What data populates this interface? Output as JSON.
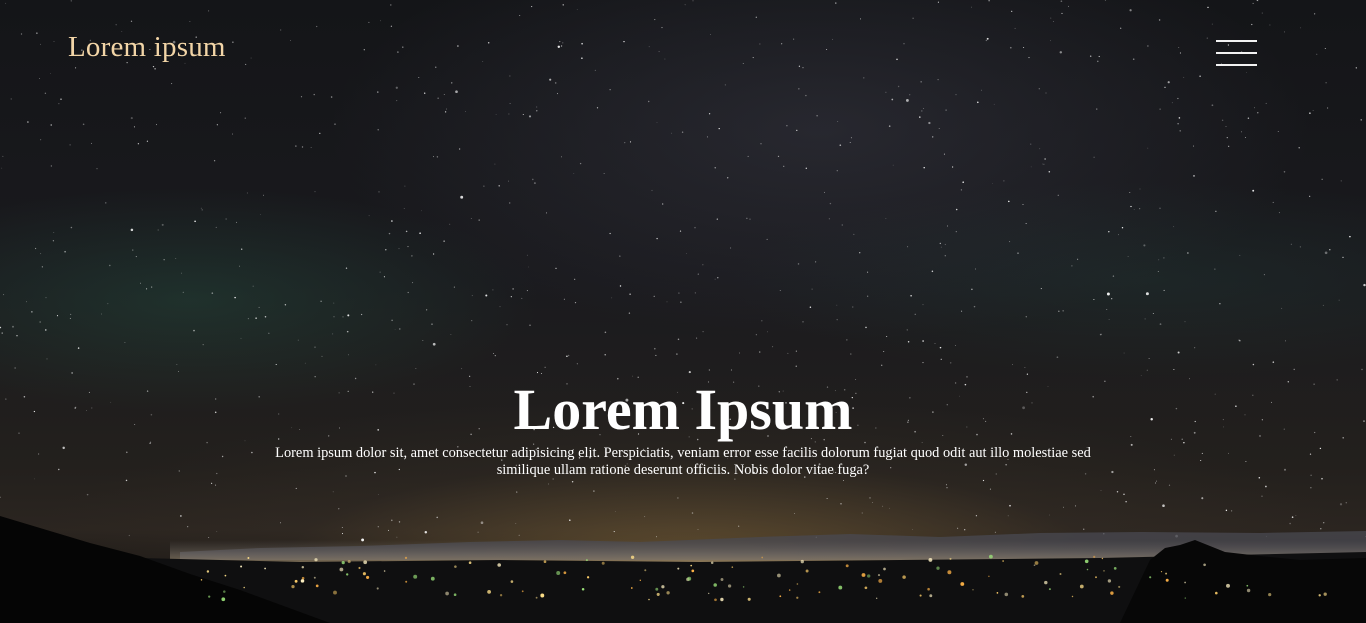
{
  "header": {
    "logo_text": "Lorem ipsum",
    "menu_icon": "hamburger-menu-icon"
  },
  "hero": {
    "title": "Lorem Ipsum",
    "description": "Lorem ipsum dolor sit, amet consectetur adipisicing elit. Perspiciatis, veniam error esse facilis dolorum fugiat quod odit aut illo molestiae sed similique ullam ratione deserunt officiis. Nobis dolor vitae fuga?",
    "background": "night-sky-stars-city-lights"
  },
  "colors": {
    "logo": "#f2d5a7",
    "text": "#ffffff",
    "sky_top": "#141518",
    "horizon_glow": "#8c6e3c"
  }
}
